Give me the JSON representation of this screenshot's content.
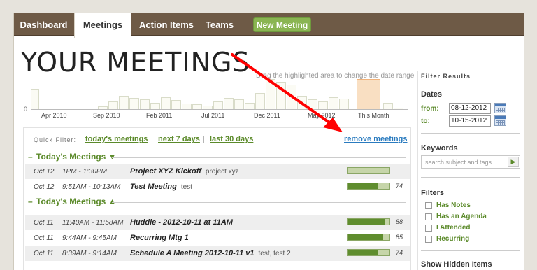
{
  "nav": {
    "tabs": [
      {
        "label": "Dashboard",
        "active": false
      },
      {
        "label": "Meetings",
        "active": true
      },
      {
        "label": "Action Items",
        "active": false
      },
      {
        "label": "Teams",
        "active": false
      }
    ],
    "new_meeting": "New Meeting"
  },
  "page_title": "YOUR MEETINGS",
  "date_hint": "Drag the highlighted area to change the date range",
  "timeline": {
    "zero": "0",
    "labels": [
      "Apr 2010",
      "Sep 2010",
      "Feb 2011",
      "Jul 2011",
      "Dec 2011",
      "May 2012",
      "This Month"
    ]
  },
  "quick_filter": {
    "label": "Quick Filter:",
    "links": [
      "today's meetings",
      "next 7 days",
      "last 30 days"
    ],
    "sep": "|",
    "remove": "remove meetings"
  },
  "sections": [
    {
      "dash": "–",
      "label": "Today's Meetings ▼"
    },
    {
      "dash": "–",
      "label": "Today's Meetings ▲"
    }
  ],
  "meetings": [
    {
      "date": "Oct 12",
      "time": "1PM - 1:30PM",
      "title": "Project XYZ Kickoff",
      "tags": "project xyz",
      "progress": 0,
      "pct": ""
    },
    {
      "date": "Oct 12",
      "time": "9:51AM - 10:13AM",
      "title": "Test Meeting",
      "tags": "test",
      "progress": 74,
      "pct": "74"
    },
    {
      "date": "Oct 11",
      "time": "11:40AM - 11:58AM",
      "title": "Huddle - 2012-10-11 at 11AM",
      "tags": "",
      "progress": 88,
      "pct": "88"
    },
    {
      "date": "Oct 11",
      "time": "9:44AM - 9:45AM",
      "title": "Recurring Mtg 1",
      "tags": "",
      "progress": 85,
      "pct": "85"
    },
    {
      "date": "Oct 11",
      "time": "8:39AM - 9:14AM",
      "title": "Schedule A Meeting 2012-10-11 v1",
      "tags": "test, test 2",
      "progress": 74,
      "pct": "74"
    }
  ],
  "sidebar": {
    "heading": "Filter Results",
    "dates_label": "Dates",
    "from_label": "from:",
    "from_value": "08-12-2012",
    "to_label": "to:",
    "to_value": "10-15-2012",
    "keywords_label": "Keywords",
    "search_placeholder": "search subject and tags",
    "filters_label": "Filters",
    "filters": [
      "Has Notes",
      "Has an Agenda",
      "I Attended",
      "Recurring"
    ],
    "hidden_label": "Show Hidden Items"
  }
}
